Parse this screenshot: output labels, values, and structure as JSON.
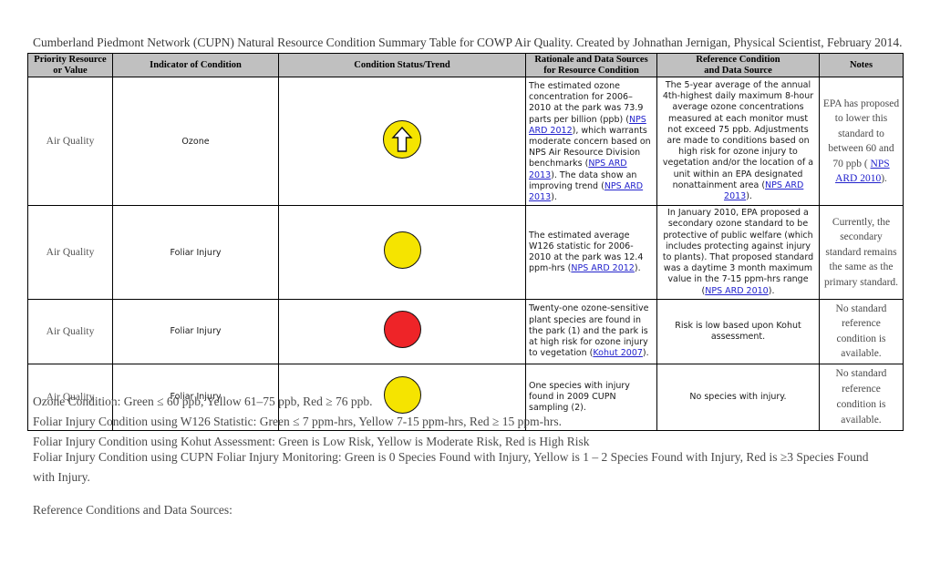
{
  "document": {
    "title": "Cumberland Piedmont Network (CUPN) Natural Resource Condition Summary Table for COWP Air Quality.  Created by Johnathan Jernigan, Physical Scientist, February 2014."
  },
  "table": {
    "headers": {
      "col1_line1": "Priority Resource",
      "col1_line2": "or Value",
      "col2": "Indicator of Condition",
      "col3": "Condition Status/Trend",
      "col4_line1": "Rationale and Data Sources",
      "col4_line2": "for Resource Condition",
      "col5_line1": "Reference Condition",
      "col5_line2": "and Data Source",
      "col6": "Notes"
    },
    "rows": [
      {
        "priority_resource": "Air Quality",
        "indicator": "Ozone",
        "status": {
          "symbol": "yellow-circle-with-up-arrow",
          "color": "#f5e400",
          "trend": "improving"
        },
        "rationale": {
          "t1": "The estimated ozone concentration for 2006",
          "t2": "2010 at the park was 73.9 parts per billion (ppb) (",
          "link1": "NPS ARD 2012",
          "t3": "), which warrants moderate concern based on NPS Air Resource Division benchmarks (",
          "link2": "NPS ARD 2013",
          "t4": "). The data show an improving trend (",
          "link3": "NPS ARD 2013",
          "t5": ")."
        },
        "reference": {
          "t1": "The 5-year average of the annual 4th-highest daily maximum 8-hour average ozone concentrations measured at each monitor must not exceed 75 ppb. Adjustments are made to conditions based on high risk for ozone injury to vegetation and/or the location of a unit within an EPA designated nonattainment area (",
          "link1": "NPS ARD 2013",
          "t2": ")."
        },
        "notes": {
          "t1": "EPA has proposed to lower this standard to between 60 and 70 ppb ( ",
          "link1": "NPS ARD 2010",
          "t2": ")."
        }
      },
      {
        "priority_resource": "Air Quality",
        "indicator": "Foliar Injury",
        "status": {
          "symbol": "yellow-circle",
          "color": "#f5e400",
          "trend": "none"
        },
        "rationale": {
          "t1": "The estimated average W126 statistic for 2006-2010 at the park was 12.4 ppm-hrs (",
          "link1": "NPS ARD 2012",
          "t2": ")."
        },
        "reference": {
          "t1": "In January 2010, EPA proposed a secondary ozone standard to be protective of public welfare (which includes protecting against injury to plants).  That proposed standard was a daytime 3 month maximum value in the 7-15 ppm-hrs range (",
          "link1": "NPS ARD 2010",
          "t2": ")."
        },
        "notes": {
          "t1": "Currently, the secondary standard remains the same as the primary standard.",
          "link1": "",
          "t2": ""
        }
      },
      {
        "priority_resource": "Air Quality",
        "indicator": "Foliar Injury",
        "status": {
          "symbol": "red-circle",
          "color": "#ee2428",
          "trend": "none"
        },
        "rationale": {
          "t1": "Twenty-one ozone-sensitive plant species are found in the park (1) and the park is at high risk for ozone injury to vegetation (",
          "link1": "Kohut 2007",
          "t2": ")."
        },
        "reference": {
          "t1": "Risk is low based upon Kohut assessment.",
          "link1": "",
          "t2": ""
        },
        "notes": {
          "t1": "No standard reference condition is available.",
          "link1": "",
          "t2": ""
        }
      },
      {
        "priority_resource": "Air Quality",
        "indicator": "Foliar Injury",
        "status": {
          "symbol": "yellow-circle",
          "color": "#f5e400",
          "trend": "none"
        },
        "rationale": {
          "t1": "One species with injury found in 2009 CUPN sampling (2).",
          "link1": "",
          "t2": ""
        },
        "reference": {
          "t1": "No species with injury.",
          "link1": "",
          "t2": ""
        },
        "notes": {
          "t1": "No standard reference condition is available.",
          "link1": "",
          "t2": ""
        }
      }
    ]
  },
  "legend": {
    "line1": "Ozone Condition: Green ≤ 60 ppb, Yellow 61–75 ppb, Red ≥ 76 ppb.",
    "line2": "Foliar Injury Condition using W126 Statistic: Green ≤ 7 ppm-hrs, Yellow 7-15 ppm-hrs, Red ≥ 15 ppm-hrs.",
    "line3": "Foliar Injury Condition using Kohut Assessment: Green is Low Risk, Yellow is Moderate Risk, Red is High Risk",
    "line4": "Foliar Injury Condition using CUPN Foliar Injury Monitoring: Green is 0 Species Found with Injury, Yellow is 1 – 2 Species Found with Injury, Red is ≥3 Species Found with Injury.",
    "references_heading": "Reference Conditions and Data Sources:"
  }
}
